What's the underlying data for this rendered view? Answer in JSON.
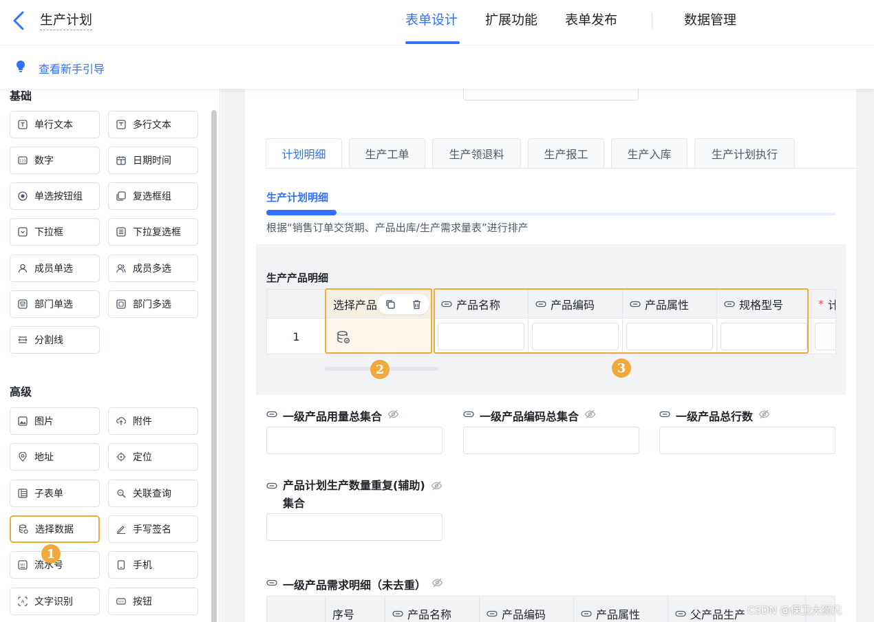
{
  "header": {
    "title": "生产计划",
    "tabs": [
      {
        "label": "表单设计",
        "active": true
      },
      {
        "label": "扩展功能",
        "active": false
      },
      {
        "label": "表单发布",
        "active": false
      },
      {
        "label": "数据管理",
        "active": false
      }
    ]
  },
  "guide": {
    "label": "查看新手引导"
  },
  "sidebar": {
    "sections": {
      "basic": "基础",
      "advanced": "高级"
    },
    "basic_items": [
      {
        "label": "单行文本",
        "icon": "text-field-icon"
      },
      {
        "label": "多行文本",
        "icon": "textarea-icon"
      },
      {
        "label": "数字",
        "icon": "number-icon"
      },
      {
        "label": "日期时间",
        "icon": "calendar-icon"
      },
      {
        "label": "单选按钮组",
        "icon": "radio-icon"
      },
      {
        "label": "复选框组",
        "icon": "checkbox-icon"
      },
      {
        "label": "下拉框",
        "icon": "dropdown-icon"
      },
      {
        "label": "下拉复选框",
        "icon": "dropdown-multi-icon"
      },
      {
        "label": "成员单选",
        "icon": "user-icon"
      },
      {
        "label": "成员多选",
        "icon": "users-icon"
      },
      {
        "label": "部门单选",
        "icon": "department-icon"
      },
      {
        "label": "部门多选",
        "icon": "departments-icon"
      },
      {
        "label": "分割线",
        "icon": "divider-icon"
      }
    ],
    "advanced_items": [
      {
        "label": "图片",
        "icon": "image-icon"
      },
      {
        "label": "附件",
        "icon": "attachment-icon"
      },
      {
        "label": "地址",
        "icon": "location-pin-icon"
      },
      {
        "label": "定位",
        "icon": "locate-icon"
      },
      {
        "label": "子表单",
        "icon": "subform-icon"
      },
      {
        "label": "关联查询",
        "icon": "link-query-icon"
      },
      {
        "label": "选择数据",
        "icon": "database-icon",
        "selected": true
      },
      {
        "label": "手写签名",
        "icon": "pen-icon"
      },
      {
        "label": "流水号",
        "icon": "serial-number-icon"
      },
      {
        "label": "手机",
        "icon": "phone-icon"
      },
      {
        "label": "文字识别",
        "icon": "ocr-icon"
      },
      {
        "label": "按钮",
        "icon": "button-icon"
      }
    ]
  },
  "form": {
    "tabs": [
      {
        "label": "计划明细",
        "active": true
      },
      {
        "label": "生产工单",
        "active": false
      },
      {
        "label": "生产领退料",
        "active": false
      },
      {
        "label": "生产报工",
        "active": false
      },
      {
        "label": "生产入库",
        "active": false
      },
      {
        "label": "生产计划执行",
        "active": false
      }
    ],
    "section_title": "生产计划明细",
    "section_desc": "根据“销售订单交货期、产品出库/生产需求量表”进行排产",
    "subform": {
      "title": "生产产品明细",
      "columns": [
        "选择产品",
        "产品名称",
        "产品编码",
        "产品属性",
        "规格型号",
        "计"
      ],
      "row_index": "1"
    },
    "markers": [
      "1",
      "2",
      "3"
    ],
    "fields": [
      {
        "label": "一级产品用量总集合"
      },
      {
        "label": "一级产品编码总集合"
      },
      {
        "label": "一级产品总行数"
      },
      {
        "label": "产品计划生产数量重复(辅助)集合"
      }
    ],
    "bottom_table": {
      "title": "一级产品需求明细（未去重）",
      "columns": [
        "序号",
        "产品名称",
        "产品编码",
        "产品属性",
        "父产品生产"
      ]
    }
  },
  "watermark": "CSDN @保卫大狮兄",
  "colors": {
    "accent": "#3370ff",
    "highlight": "#f0a93b",
    "required": "#f53f3f"
  }
}
